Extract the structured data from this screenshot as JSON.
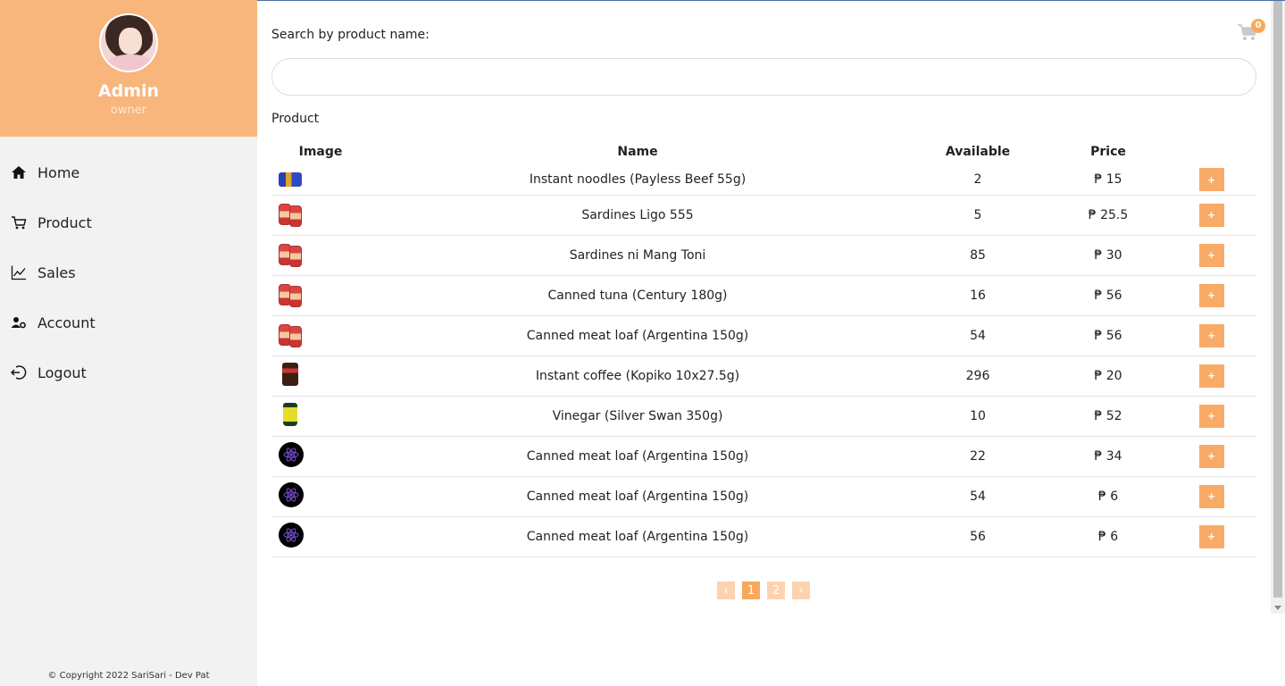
{
  "sidebar": {
    "user_name": "Admin",
    "user_role": "owner",
    "items": [
      {
        "label": "Home",
        "icon": "home-icon"
      },
      {
        "label": "Product",
        "icon": "cart-icon"
      },
      {
        "label": "Sales",
        "icon": "chart-line-icon"
      },
      {
        "label": "Account",
        "icon": "user-gear-icon"
      },
      {
        "label": "Logout",
        "icon": "logout-icon"
      }
    ],
    "copyright": "© Copyright 2022 SariSari - Dev Pat"
  },
  "header": {
    "search_label": "Search by product name:",
    "search_value": "",
    "cart_count": "0"
  },
  "product_section": {
    "title": "Product",
    "columns": {
      "image": "Image",
      "name": "Name",
      "available": "Available",
      "price": "Price"
    },
    "add_label": "+",
    "rows": [
      {
        "image": "noodle",
        "name": "Instant noodles (Payless Beef 55g)",
        "available": "2",
        "price": "₱ 15"
      },
      {
        "image": "cans",
        "name": "Sardines Ligo 555",
        "available": "5",
        "price": "₱ 25.5"
      },
      {
        "image": "cans",
        "name": "Sardines ni Mang Toni",
        "available": "85",
        "price": "₱ 30"
      },
      {
        "image": "cans",
        "name": "Canned tuna (Century 180g)",
        "available": "16",
        "price": "₱ 56"
      },
      {
        "image": "cans",
        "name": "Canned meat loaf (Argentina 150g)",
        "available": "54",
        "price": "₱ 56"
      },
      {
        "image": "coffee",
        "name": "Instant coffee (Kopiko 10x27.5g)",
        "available": "296",
        "price": "₱ 20"
      },
      {
        "image": "vinegar",
        "name": "Vinegar (Silver Swan 350g)",
        "available": "10",
        "price": "₱ 52"
      },
      {
        "image": "react",
        "name": "Canned meat loaf (Argentina 150g)",
        "available": "22",
        "price": "₱ 34"
      },
      {
        "image": "react",
        "name": "Canned meat loaf (Argentina 150g)",
        "available": "54",
        "price": "₱ 6"
      },
      {
        "image": "react",
        "name": "Canned meat loaf (Argentina 150g)",
        "available": "56",
        "price": "₱ 6"
      }
    ]
  },
  "pagination": {
    "prev": "‹",
    "pages": [
      "1",
      "2"
    ],
    "current": "1",
    "next": "›"
  },
  "colors": {
    "accent": "#f8a85c",
    "sidebar_header": "#f8b57c",
    "sidebar_bg": "#f2f2f2"
  }
}
